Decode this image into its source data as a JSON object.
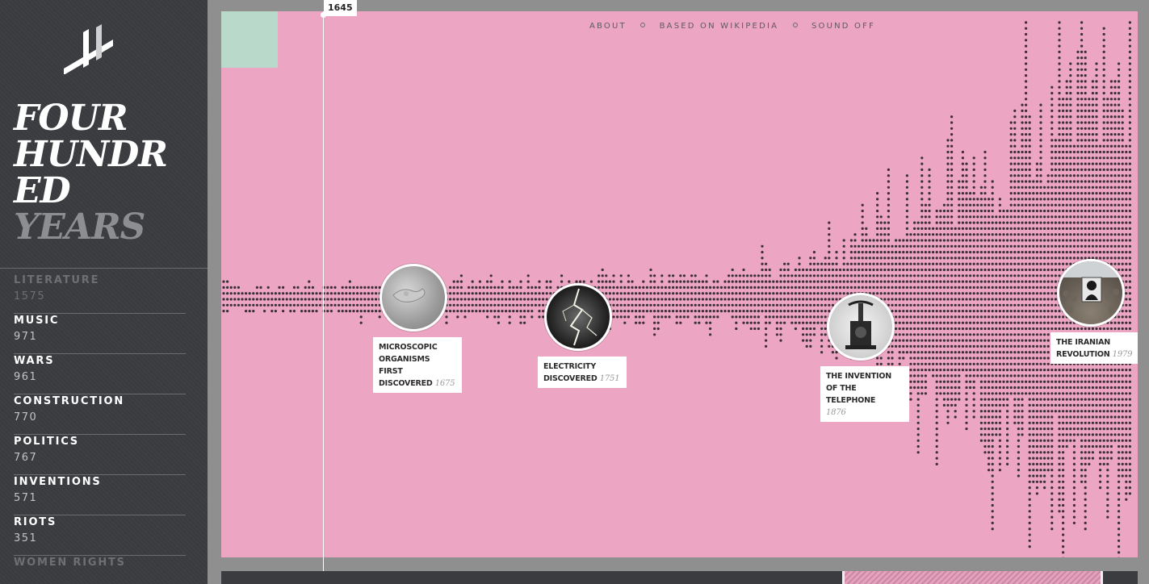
{
  "app": {
    "title_lines": [
      "FOUR",
      "HUNDR",
      "ED"
    ],
    "title_accent": "YEARS"
  },
  "nav": {
    "items": [
      "ABOUT",
      "BASED ON WIKIPEDIA",
      "SOUND OFF"
    ]
  },
  "categories": [
    {
      "name": "LITERATURE",
      "count": "1575",
      "active": false
    },
    {
      "name": "MUSIC",
      "count": "971",
      "active": true
    },
    {
      "name": "WARS",
      "count": "961",
      "active": true
    },
    {
      "name": "CONSTRUCTION",
      "count": "770",
      "active": true
    },
    {
      "name": "POLITICS",
      "count": "767",
      "active": true
    },
    {
      "name": "INVENTIONS",
      "count": "571",
      "active": true
    },
    {
      "name": "RIOTS",
      "count": "351",
      "active": true
    },
    {
      "name": "WOMEN RIGHTS",
      "count": "",
      "active": false
    }
  ],
  "timeline": {
    "current_year": "1645"
  },
  "events": [
    {
      "title": "MICROSCOPIC ORGANISMS FIRST DISCOVERED",
      "year": "1675",
      "image": "microorganism-photo"
    },
    {
      "title": "ELECTRICITY DISCOVERED",
      "year": "1751",
      "image": "lightning-photo"
    },
    {
      "title": "THE INVENTION OF THE TELEPHONE",
      "year": "1876",
      "image": "telephone-photo"
    },
    {
      "title": "THE IRANIAN REVOLUTION",
      "year": "1979",
      "image": "revolution-portrait-photo"
    }
  ],
  "colors": {
    "panel": "#eca6c3",
    "sidebar": "#3b3c40",
    "dots": "#3a2f36",
    "accent_mint": "#b9d9cb"
  }
}
